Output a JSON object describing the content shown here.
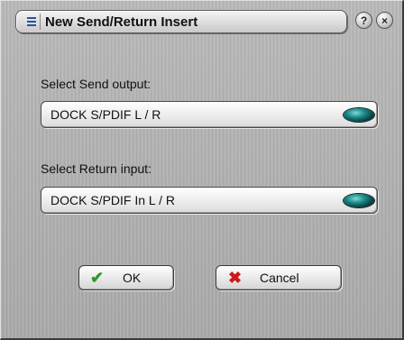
{
  "window": {
    "title": "New Send/Return Insert",
    "help_glyph": "?",
    "close_glyph": "×"
  },
  "send": {
    "label": "Select Send output:",
    "value": "DOCK S/PDIF L / R"
  },
  "return": {
    "label": "Select Return input:",
    "value": "DOCK S/PDIF In L / R"
  },
  "buttons": {
    "ok_label": "OK",
    "cancel_label": "Cancel"
  },
  "icons": {
    "menu": "menu-icon",
    "ok": "checkmark-icon",
    "cancel": "x-icon",
    "dropdown_knob": "dropdown-knob-icon"
  },
  "colors": {
    "ok_check": "#2e9a2e",
    "cancel_x": "#cc1a1a",
    "knob": "#1a8a8a",
    "menu_icon": "#2b4fa8"
  }
}
